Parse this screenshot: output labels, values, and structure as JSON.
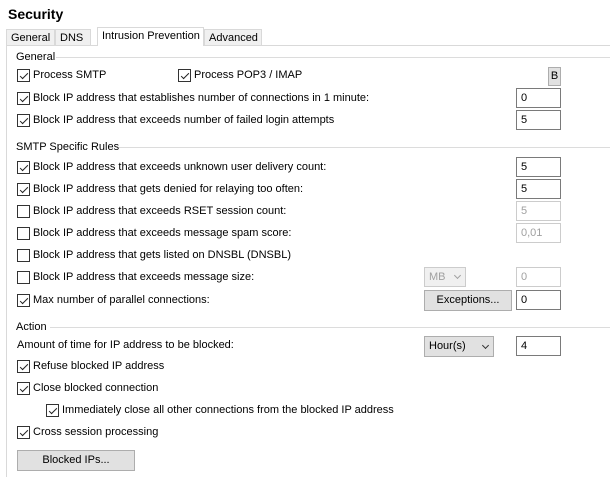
{
  "page_title": "Security",
  "tabs": [
    "General",
    "DNS",
    "Intrusion Prevention",
    "Advanced"
  ],
  "groups": {
    "general": "General",
    "smtp": "SMTP Specific Rules",
    "action": "Action"
  },
  "general": {
    "process_smtp": "Process SMTP",
    "process_pop3": "Process POP3 / IMAP",
    "b_button": "B",
    "block_connections": "Block IP address that establishes number of connections in 1 minute:",
    "block_connections_value": "0",
    "block_failed_login": "Block IP address that exceeds number of failed login attempts",
    "block_failed_login_value": "5"
  },
  "smtp": {
    "unknown_user": "Block IP address that exceeds unknown user delivery count:",
    "unknown_user_value": "5",
    "relaying": "Block IP address that gets denied for relaying too often:",
    "relaying_value": "5",
    "rset": "Block IP address that exceeds RSET session count:",
    "rset_value": "5",
    "spam_score": "Block IP address that exceeds message spam score:",
    "spam_score_value": "0,01",
    "dnsbl": "Block IP address that gets listed on DNSBL (DNSBL)",
    "msg_size": "Block IP address that exceeds message size:",
    "msg_size_unit": "MB",
    "msg_size_value": "0",
    "parallel": "Max number of parallel connections:",
    "exceptions_button": "Exceptions...",
    "parallel_value": "0"
  },
  "action": {
    "block_time_label": "Amount of time for IP address to be blocked:",
    "block_time_unit": "Hour(s)",
    "block_time_value": "4",
    "refuse": "Refuse blocked IP address",
    "close": "Close blocked connection",
    "close_all": "Immediately close all other connections from the blocked IP address",
    "cross_session": "Cross session processing",
    "blocked_ips_button": "Blocked IPs..."
  }
}
